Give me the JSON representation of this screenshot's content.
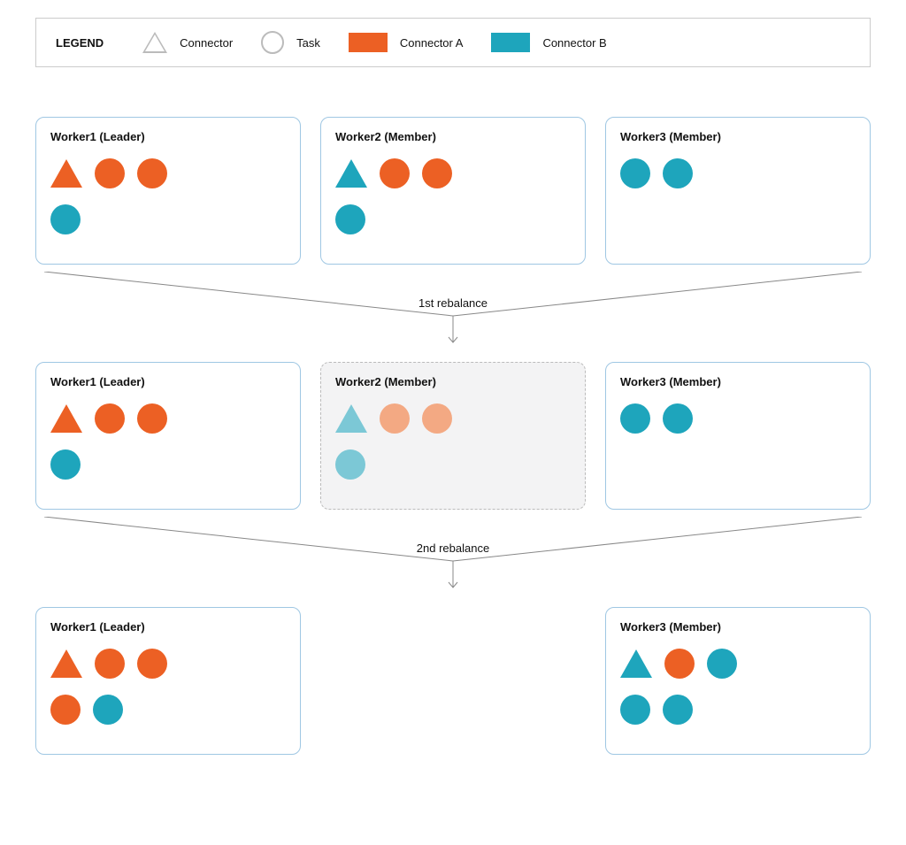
{
  "legend": {
    "title": "LEGEND",
    "connector_label": "Connector",
    "task_label": "Task",
    "connectorA_label": "Connector A",
    "connectorB_label": "Connector B"
  },
  "colors": {
    "orange": "#ec6024",
    "teal": "#1ea5bc"
  },
  "transitions": {
    "first": "1st rebalance",
    "second": "2nd rebalance"
  },
  "stages": [
    {
      "workers": [
        {
          "title": "Worker1 (Leader)",
          "faded": false,
          "rows": [
            [
              {
                "shape": "triangle",
                "color": "orange"
              },
              {
                "shape": "circle",
                "color": "orange"
              },
              {
                "shape": "circle",
                "color": "orange"
              }
            ],
            [
              {
                "shape": "circle",
                "color": "teal"
              }
            ]
          ]
        },
        {
          "title": "Worker2 (Member)",
          "faded": false,
          "rows": [
            [
              {
                "shape": "triangle",
                "color": "teal"
              },
              {
                "shape": "circle",
                "color": "orange"
              },
              {
                "shape": "circle",
                "color": "orange"
              }
            ],
            [
              {
                "shape": "circle",
                "color": "teal"
              }
            ]
          ]
        },
        {
          "title": "Worker3 (Member)",
          "faded": false,
          "rows": [
            [
              {
                "shape": "circle",
                "color": "teal"
              },
              {
                "shape": "circle",
                "color": "teal"
              }
            ]
          ]
        }
      ]
    },
    {
      "workers": [
        {
          "title": "Worker1 (Leader)",
          "faded": false,
          "rows": [
            [
              {
                "shape": "triangle",
                "color": "orange"
              },
              {
                "shape": "circle",
                "color": "orange"
              },
              {
                "shape": "circle",
                "color": "orange"
              }
            ],
            [
              {
                "shape": "circle",
                "color": "teal"
              }
            ]
          ]
        },
        {
          "title": "Worker2 (Member)",
          "faded": true,
          "rows": [
            [
              {
                "shape": "triangle",
                "color": "teal",
                "faded": true
              },
              {
                "shape": "circle",
                "color": "orange",
                "faded": true
              },
              {
                "shape": "circle",
                "color": "orange",
                "faded": true
              }
            ],
            [
              {
                "shape": "circle",
                "color": "teal",
                "faded": true
              }
            ]
          ]
        },
        {
          "title": "Worker3 (Member)",
          "faded": false,
          "rows": [
            [
              {
                "shape": "circle",
                "color": "teal"
              },
              {
                "shape": "circle",
                "color": "teal"
              }
            ]
          ]
        }
      ]
    },
    {
      "workers": [
        {
          "title": "Worker1 (Leader)",
          "faded": false,
          "rows": [
            [
              {
                "shape": "triangle",
                "color": "orange"
              },
              {
                "shape": "circle",
                "color": "orange"
              },
              {
                "shape": "circle",
                "color": "orange"
              }
            ],
            [
              {
                "shape": "circle",
                "color": "orange"
              },
              {
                "shape": "circle",
                "color": "teal"
              }
            ]
          ]
        },
        null,
        {
          "title": "Worker3 (Member)",
          "faded": false,
          "rows": [
            [
              {
                "shape": "triangle",
                "color": "teal"
              },
              {
                "shape": "circle",
                "color": "orange"
              },
              {
                "shape": "circle",
                "color": "teal"
              }
            ],
            [
              {
                "shape": "circle",
                "color": "teal"
              },
              {
                "shape": "circle",
                "color": "teal"
              }
            ]
          ]
        }
      ]
    }
  ]
}
